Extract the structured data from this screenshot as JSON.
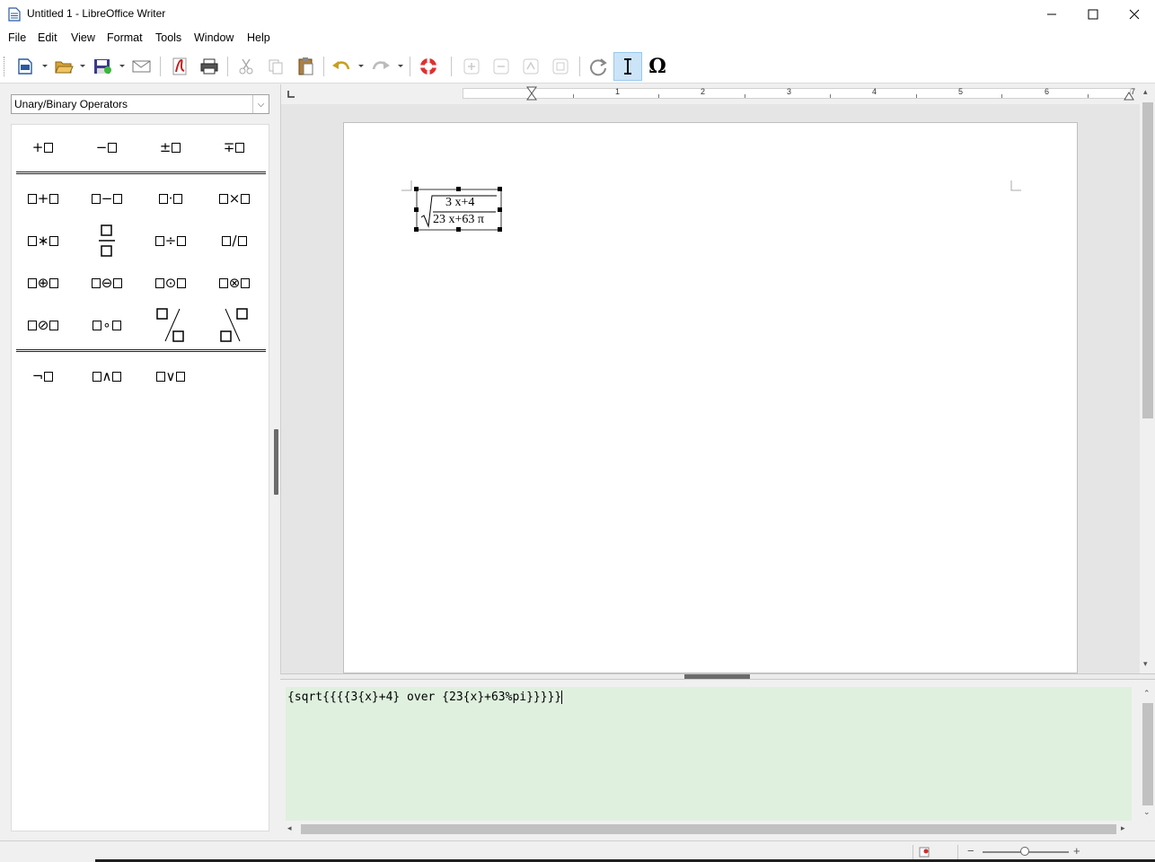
{
  "window": {
    "title": "Untitled 1 - LibreOffice Writer",
    "minimize": "—",
    "maximize": "☐",
    "close": "✕"
  },
  "menu": [
    "File",
    "Edit",
    "View",
    "Format",
    "Tools",
    "Window",
    "Help"
  ],
  "toolbar": {
    "buttons": [
      "new-document",
      "open",
      "save",
      "email",
      "export-pdf",
      "print",
      "cut",
      "copy",
      "paste",
      "undo",
      "redo",
      "help",
      "zoom-in",
      "zoom-out",
      "show-all",
      "zoom-100",
      "update",
      "formula-cursor",
      "symbols"
    ],
    "symbols_glyph": "Ω"
  },
  "elements_panel": {
    "category": "Unary/Binary Operators",
    "unary": [
      "+",
      "−",
      "±",
      "∓"
    ],
    "binary_row1": [
      "+",
      "−",
      "·",
      "×"
    ],
    "binary_row2": [
      "∗",
      "over",
      "÷",
      "/"
    ],
    "binary_row3": [
      "⊕",
      "⊖",
      "⊙",
      "⊗"
    ],
    "binary_row4": [
      "⊘",
      "∘",
      "wideslash",
      "widebslash"
    ],
    "logic": [
      "¬",
      "∧",
      "∨"
    ]
  },
  "ruler": {
    "numbers": [
      "1",
      "2",
      "3",
      "4",
      "5",
      "6",
      "7"
    ]
  },
  "formula": {
    "numerator": "3 x+4",
    "denominator": "23 x+63 π",
    "radical": "√"
  },
  "command": {
    "text": "{sqrt{{{{3{x}+4} over {23{x}+63%pi}}}}}"
  }
}
